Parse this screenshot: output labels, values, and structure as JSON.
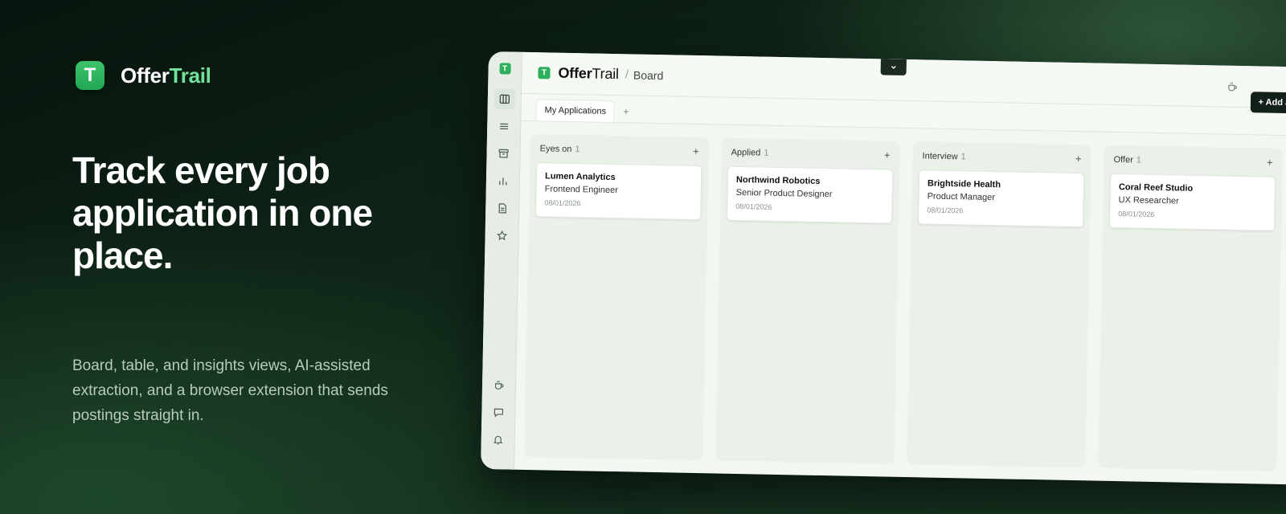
{
  "hero": {
    "brand": {
      "logo_letter": "T",
      "name_part1": "Offer",
      "name_part2": "Trail"
    },
    "headline": "Track every job application in one place.",
    "subcopy": "Board, table, and insights views, AI-assisted extraction, and a browser extension that sends postings straight in."
  },
  "app": {
    "topbar": {
      "logo_letter": "T",
      "brand_part1": "Offer",
      "brand_part2": "Trail",
      "separator": "/",
      "breadcrumb": "Board",
      "add_button": "+ Add applica"
    },
    "tabs": [
      {
        "label": "My Applications",
        "active": true
      }
    ],
    "tab_add": "+",
    "rail": {
      "logo_letter": "T",
      "top_icons": [
        "board-icon",
        "list-icon",
        "archive-icon",
        "insights-icon",
        "document-icon",
        "star-icon"
      ],
      "bottom_icons": [
        "coffee-icon",
        "chat-icon",
        "bell-icon"
      ]
    },
    "columns": [
      {
        "title": "Eyes on",
        "count": "1",
        "add": "+",
        "cards": [
          {
            "company": "Lumen Analytics",
            "role": "Frontend Engineer",
            "date": "08/01/2026"
          }
        ]
      },
      {
        "title": "Applied",
        "count": "1",
        "add": "+",
        "cards": [
          {
            "company": "Northwind Robotics",
            "role": "Senior Product Designer",
            "date": "08/01/2026"
          }
        ]
      },
      {
        "title": "Interview",
        "count": "1",
        "add": "+",
        "cards": [
          {
            "company": "Brightside Health",
            "role": "Product Manager",
            "date": "08/01/2026"
          }
        ]
      },
      {
        "title": "Offer",
        "count": "1",
        "add": "+",
        "cards": [
          {
            "company": "Coral Reef Studio",
            "role": "UX Researcher",
            "date": "08/01/2026"
          }
        ]
      }
    ]
  },
  "colors": {
    "brand_green": "#2db05c",
    "brand_accent_text": "#6fe39a",
    "hero_bg_dark": "#07140d",
    "app_bg": "#f2f7f1",
    "button_dark": "#14201a"
  }
}
